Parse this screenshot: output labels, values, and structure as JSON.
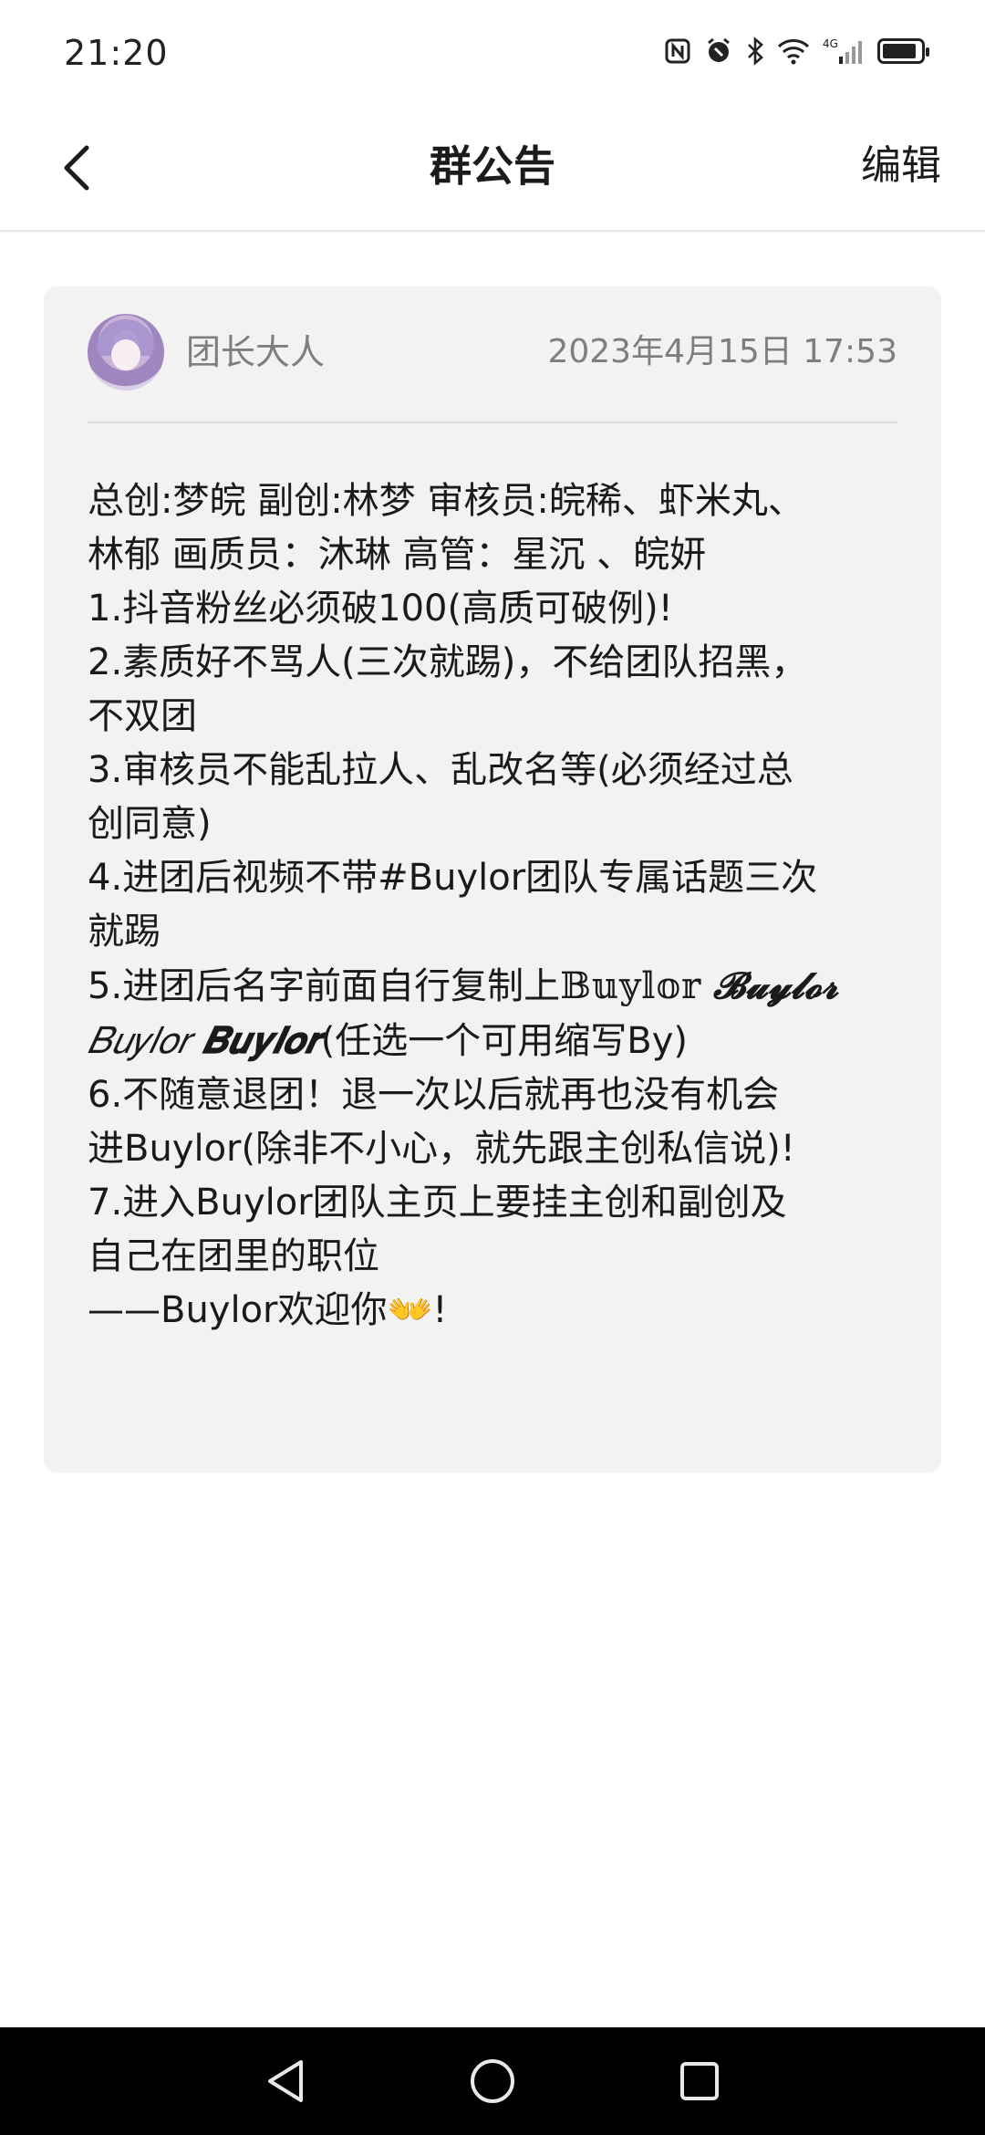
{
  "status_bar": {
    "time": "21:20",
    "icons": [
      "nfc-icon",
      "alarm-icon",
      "bluetooth-icon",
      "wifi-icon",
      "cellular-4g-icon",
      "battery-icon"
    ],
    "network_label": "4G"
  },
  "header": {
    "title": "群公告",
    "edit_label": "编辑"
  },
  "post": {
    "author": "团长大人",
    "timestamp": "2023年4月15日 17:53",
    "lines": [
      "总创:梦皖 副创:林梦 审核员:皖稀、虾米丸、",
      "林郁  画质员：沐琳 高管：星沉 、皖妍",
      "1.抖音粉丝必须破100(高质可破例)!",
      "2.素质好不骂人(三次就踢)，不给团队招黑，",
      "不双团",
      "3.审核员不能乱拉人、乱改名等(必须经过总",
      "创同意)",
      "4.进团后视频不带#Buylor团队专属话题三次",
      "就踢"
    ],
    "line5_prefix": "5.进团后名字前面自行复制上",
    "fancy_names": [
      "𝔹𝕦𝕪𝕝𝕠𝕣",
      "𝓑𝓾𝔂𝓵𝓸𝓻",
      "𝐵𝑢𝑦𝑙𝑜𝑟",
      "𝑩𝒖𝒚𝒍𝒐𝒓"
    ],
    "line5_suffix": "(任选一个可用缩写By)",
    "lines_after": [
      "6.不随意退团！退一次以后就再也没有机会",
      "进Buylor(除非不小心，就先跟主创私信说)!",
      "7.进入Buylor团队主页上要挂主创和副创及",
      "自己在团里的职位"
    ],
    "closing_prefix": "——Buylor欢迎你",
    "closing_emoji": "👐",
    "closing_suffix": "!"
  },
  "nav": {
    "buttons": [
      "back-nav",
      "home-nav",
      "recents-nav"
    ]
  }
}
